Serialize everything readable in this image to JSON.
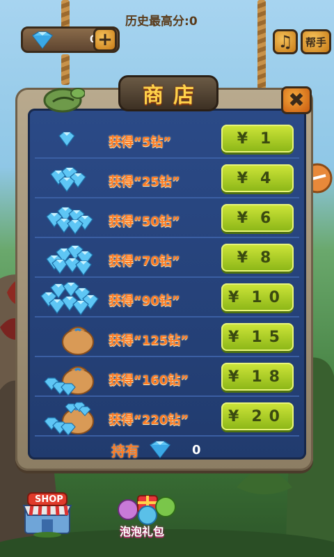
{
  "header": {
    "high_score_label": "历史最高分:",
    "high_score_value": "0",
    "gem_count": "0",
    "plus_label": "+",
    "music_label": "♫",
    "help_label": "帮手"
  },
  "shop": {
    "title": "商店",
    "close_label": "✖",
    "currency_symbol": "¥",
    "items": [
      {
        "label": "获得“5钻”",
        "price": "1"
      },
      {
        "label": "获得“25钻”",
        "price": "4"
      },
      {
        "label": "获得“50钻”",
        "price": "6"
      },
      {
        "label": "获得“70钻”",
        "price": "8"
      },
      {
        "label": "获得“90钻”",
        "price": "10"
      },
      {
        "label": "获得“125钻”",
        "price": "15"
      },
      {
        "label": "获得“160钻”",
        "price": "18"
      },
      {
        "label": "获得“220钻”",
        "price": "20"
      }
    ],
    "holdings_label": "持有",
    "holdings_value": "0"
  },
  "bottom": {
    "shop_label": "SHOP",
    "gift_label": "泡泡礼包"
  },
  "colors": {
    "panel_blue": "#2b4a87",
    "button_green": "#a8cc22",
    "label_orange": "#ff7a22",
    "title_gold": "#ffd24a"
  }
}
